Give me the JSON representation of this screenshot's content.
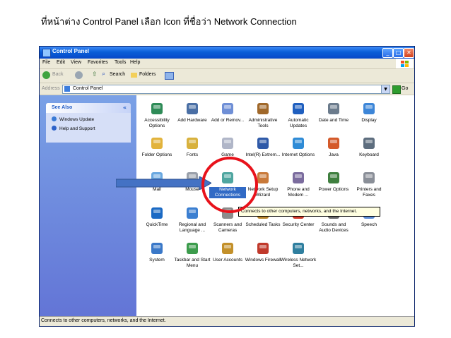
{
  "caption": "ที่หน้าต่าง Control Panel เลือก Icon ที่ชื่อว่า Network Connection",
  "window": {
    "title": "Control Panel",
    "buttons": {
      "minimize": "_",
      "maximize": "□",
      "close": "✕"
    }
  },
  "menu": [
    "File",
    "Edit",
    "View",
    "Favorites",
    "Tools",
    "Help"
  ],
  "toolbar": {
    "back": "Back",
    "search": "Search",
    "folders": "Folders"
  },
  "address": {
    "label": "Address",
    "value": "Control Panel",
    "go": "Go"
  },
  "see_also": {
    "title": "See Also",
    "links": [
      "Windows Update",
      "Help and Support"
    ]
  },
  "items": [
    {
      "label": "Accessibility Options",
      "icon": "accessibility-icon"
    },
    {
      "label": "Add Hardware",
      "icon": "add-hardware-icon"
    },
    {
      "label": "Add or Remov...",
      "icon": "add-remove-programs-icon"
    },
    {
      "label": "Administrative Tools",
      "icon": "administrative-tools-icon"
    },
    {
      "label": "Automatic Updates",
      "icon": "automatic-updates-icon"
    },
    {
      "label": "Date and Time",
      "icon": "date-time-icon"
    },
    {
      "label": "Display",
      "icon": "display-icon"
    },
    {
      "label": "Folder Options",
      "icon": "folder-options-icon"
    },
    {
      "label": "Fonts",
      "icon": "fonts-icon"
    },
    {
      "label": "Game",
      "icon": "game-controllers-icon"
    },
    {
      "label": "Intel(R) Extrem...",
      "icon": "intel-graphics-icon"
    },
    {
      "label": "Internet Options",
      "icon": "internet-options-icon"
    },
    {
      "label": "Java",
      "icon": "java-icon"
    },
    {
      "label": "Keyboard",
      "icon": "keyboard-icon"
    },
    {
      "label": "Mail",
      "icon": "mail-icon"
    },
    {
      "label": "Mouse",
      "icon": "mouse-icon"
    },
    {
      "label": "Network Connections",
      "icon": "network-connections-icon"
    },
    {
      "label": "Network Setup Wizard",
      "icon": "network-setup-icon"
    },
    {
      "label": "Phone and Modem ...",
      "icon": "phone-modem-icon"
    },
    {
      "label": "Power Options",
      "icon": "power-options-icon"
    },
    {
      "label": "Printers and Faxes",
      "icon": "printers-faxes-icon"
    },
    {
      "label": "QuickTime",
      "icon": "quicktime-icon"
    },
    {
      "label": "Regional and Language ...",
      "icon": "regional-language-icon"
    },
    {
      "label": "Scanners and Cameras",
      "icon": "scanners-cameras-icon"
    },
    {
      "label": "Scheduled Tasks",
      "icon": "scheduled-tasks-icon"
    },
    {
      "label": "Security Center",
      "icon": "security-center-icon"
    },
    {
      "label": "Sounds and Audio Devices",
      "icon": "sounds-audio-icon"
    },
    {
      "label": "Speech",
      "icon": "speech-icon"
    },
    {
      "label": "System",
      "icon": "system-icon"
    },
    {
      "label": "Taskbar and Start Menu",
      "icon": "taskbar-start-icon"
    },
    {
      "label": "User Accounts",
      "icon": "user-accounts-icon"
    },
    {
      "label": "Windows Firewall",
      "icon": "windows-firewall-icon"
    },
    {
      "label": "Wireless Network Set...",
      "icon": "wireless-network-icon"
    }
  ],
  "tooltip": "Connects to other computers, networks, and the Internet.",
  "status": "Connects to other computers, networks, and the Internet.",
  "colors": {
    "highlight_ring": "#e8121b",
    "arrow": "#4472c4",
    "selection": "#316ac5"
  }
}
